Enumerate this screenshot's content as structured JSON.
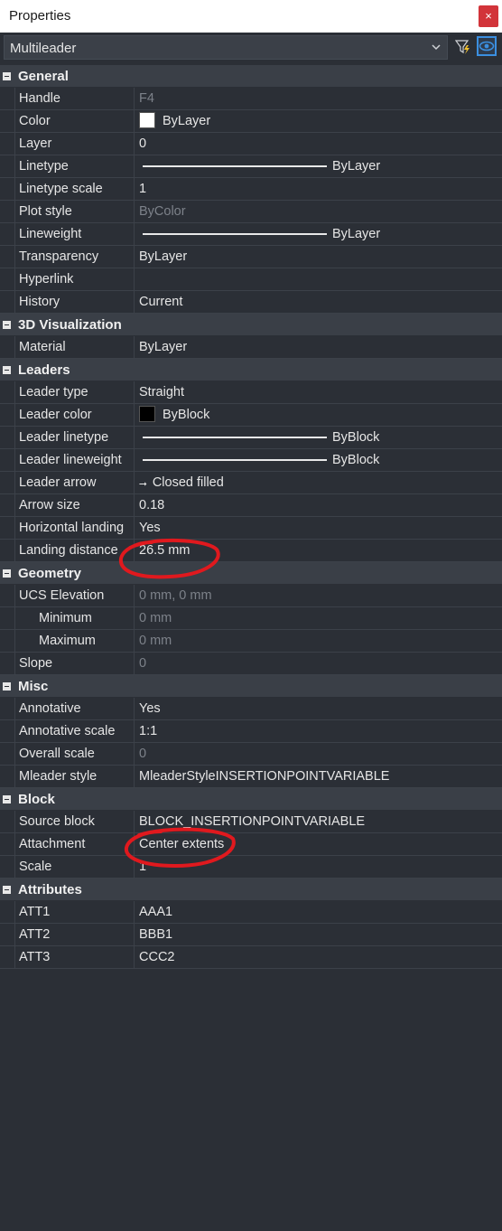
{
  "title": "Properties",
  "close_glyph": "×",
  "selector_value": "Multileader",
  "icons": {
    "filter": "filter-lightning-icon",
    "eye": "eye-icon",
    "close": "close-icon",
    "chevron": "chevron-down-icon"
  },
  "colors": {
    "accent": "#3b8fe0",
    "close_bg": "#d2343a",
    "annotation": "#e0191e"
  },
  "sections": {
    "general": {
      "label": "General",
      "handle": {
        "key": "Handle",
        "val": "F4"
      },
      "color": {
        "key": "Color",
        "val": "ByLayer",
        "swatch": "#ffffff"
      },
      "layer": {
        "key": "Layer",
        "val": "0"
      },
      "linetype": {
        "key": "Linetype",
        "val": "ByLayer"
      },
      "linetype_scale": {
        "key": "Linetype scale",
        "val": "1"
      },
      "plot_style": {
        "key": "Plot style",
        "val": "ByColor"
      },
      "lineweight": {
        "key": "Lineweight",
        "val": "ByLayer"
      },
      "transparency": {
        "key": "Transparency",
        "val": "ByLayer"
      },
      "hyperlink": {
        "key": "Hyperlink",
        "val": ""
      },
      "history": {
        "key": "History",
        "val": "Current"
      }
    },
    "viz": {
      "label": "3D Visualization",
      "material": {
        "key": "Material",
        "val": "ByLayer"
      }
    },
    "leaders": {
      "label": "Leaders",
      "leader_type": {
        "key": "Leader type",
        "val": "Straight"
      },
      "leader_color": {
        "key": "Leader color",
        "val": "ByBlock",
        "swatch": "#000000"
      },
      "leader_linetype": {
        "key": "Leader linetype",
        "val": "ByBlock"
      },
      "leader_lineweight": {
        "key": "Leader lineweight",
        "val": "ByBlock"
      },
      "leader_arrow": {
        "key": "Leader arrow",
        "val": "Closed filled"
      },
      "arrow_size": {
        "key": "Arrow size",
        "val": "0.18"
      },
      "horizontal_landing": {
        "key": "Horizontal landing",
        "val": "Yes"
      },
      "landing_distance": {
        "key": "Landing distance",
        "val": "26.5 mm"
      }
    },
    "geometry": {
      "label": "Geometry",
      "ucs_elevation": {
        "key": "UCS Elevation",
        "val": "0 mm, 0 mm"
      },
      "minimum": {
        "key": "Minimum",
        "val": "0 mm"
      },
      "maximum": {
        "key": "Maximum",
        "val": "0 mm"
      },
      "slope": {
        "key": "Slope",
        "val": "0"
      }
    },
    "misc": {
      "label": "Misc",
      "annotative": {
        "key": "Annotative",
        "val": "Yes"
      },
      "annotative_scale": {
        "key": "Annotative scale",
        "val": "1:1"
      },
      "overall_scale": {
        "key": "Overall scale",
        "val": "0"
      },
      "mleader_style": {
        "key": "Mleader style",
        "val": "MleaderStyleINSERTIONPOINTVARIABLE"
      }
    },
    "block": {
      "label": "Block",
      "source_block": {
        "key": "Source block",
        "val": "BLOCK_INSERTIONPOINTVARIABLE"
      },
      "attachment": {
        "key": "Attachment",
        "val": "Center extents"
      },
      "scale": {
        "key": "Scale",
        "val": "1"
      }
    },
    "attributes": {
      "label": "Attributes",
      "att1": {
        "key": "ATT1",
        "val": "AAA1"
      },
      "att2": {
        "key": "ATT2",
        "val": "BBB1"
      },
      "att3": {
        "key": "ATT3",
        "val": "CCC2"
      }
    }
  }
}
